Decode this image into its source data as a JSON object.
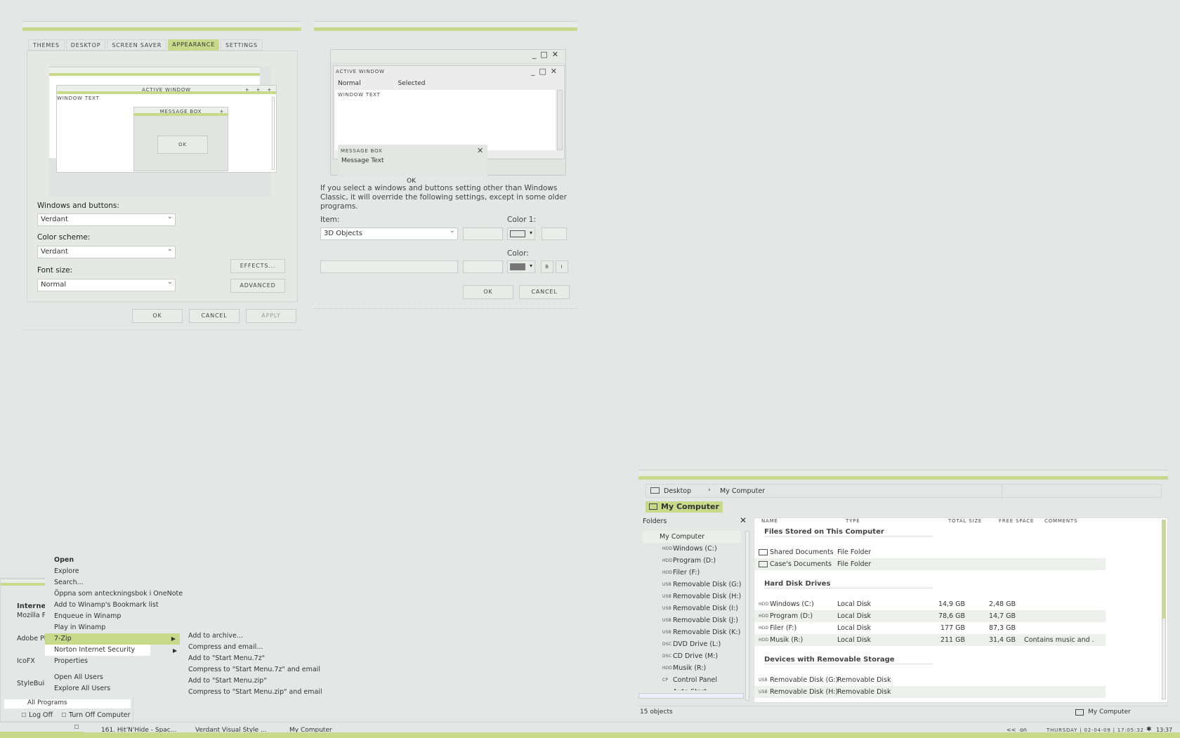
{
  "display_props": {
    "tabs": [
      {
        "label": "Themes"
      },
      {
        "label": "Desktop"
      },
      {
        "label": "Screen Saver"
      },
      {
        "label": "Appearance",
        "selected": true
      },
      {
        "label": "Settings"
      }
    ],
    "preview": {
      "active_window": "Active Window",
      "window_text": "Window Text",
      "message_box": "Message Box",
      "ok": "OK"
    },
    "windows_buttons_label": "Windows and buttons:",
    "windows_buttons_value": "Verdant",
    "color_scheme_label": "Color scheme:",
    "color_scheme_value": "Verdant",
    "font_size_label": "Font size:",
    "font_size_value": "Normal",
    "effects": "Effects...",
    "advanced": "Advanced",
    "ok": "OK",
    "cancel": "Cancel",
    "apply": "Apply"
  },
  "advanced_appearance": {
    "preview": {
      "active_window": "Active Window",
      "normal": "Normal",
      "selected": "Selected",
      "window_text": "Window Text",
      "message_box": "Message Box",
      "message_text": "Message Text",
      "ok": "OK"
    },
    "info": "If you select a windows and buttons setting other than Windows Classic, it will override the following settings, except in some older programs.",
    "item_label": "Item:",
    "item_value": "3D Objects",
    "color1_label": "Color 1:",
    "color_label": "Color:",
    "bold": "B",
    "italic": "I",
    "ok": "OK",
    "cancel": "Cancel"
  },
  "explorer": {
    "breadcrumb": [
      "Desktop",
      "My Computer"
    ],
    "title": "My Computer",
    "folders_label": "Folders",
    "tree": [
      {
        "tag": "",
        "label": "My Computer"
      },
      {
        "tag": "HDD",
        "label": "Windows (C:)"
      },
      {
        "tag": "HDD",
        "label": "Program (D:)"
      },
      {
        "tag": "HDD",
        "label": "Filer (F:)"
      },
      {
        "tag": "USB",
        "label": "Removable Disk (G:)"
      },
      {
        "tag": "USB",
        "label": "Removable Disk (H:)"
      },
      {
        "tag": "USB",
        "label": "Removable Disk (I:)"
      },
      {
        "tag": "USB",
        "label": "Removable Disk (J:)"
      },
      {
        "tag": "USB",
        "label": "Removable Disk (K:)"
      },
      {
        "tag": "DSC",
        "label": "DVD Drive (L:)"
      },
      {
        "tag": "DSC",
        "label": "CD Drive (M:)"
      },
      {
        "tag": "HDD",
        "label": "Musik (R:)"
      },
      {
        "tag": "CP",
        "label": "Control Panel"
      },
      {
        "tag": "",
        "label": "Auto Start"
      }
    ],
    "columns": [
      "Name",
      "Type",
      "Total Size",
      "Free Space",
      "Comments"
    ],
    "groups": [
      {
        "title": "Files Stored on This Computer",
        "rows": [
          {
            "tag": "",
            "name": "Shared Documents",
            "type": "File Folder",
            "total": "",
            "free": "",
            "comment": ""
          },
          {
            "tag": "",
            "name": "Case's Documents",
            "type": "File Folder",
            "total": "",
            "free": "",
            "comment": ""
          }
        ]
      },
      {
        "title": "Hard Disk Drives",
        "rows": [
          {
            "tag": "HDD",
            "name": "Windows (C:)",
            "type": "Local Disk",
            "total": "14,9 GB",
            "free": "2,48 GB",
            "comment": ""
          },
          {
            "tag": "HDD",
            "name": "Program (D:)",
            "type": "Local Disk",
            "total": "78,6 GB",
            "free": "14,7 GB",
            "comment": ""
          },
          {
            "tag": "HDD",
            "name": "Filer (F:)",
            "type": "Local Disk",
            "total": "177 GB",
            "free": "87,3 GB",
            "comment": ""
          },
          {
            "tag": "HDD",
            "name": "Musik (R:)",
            "type": "Local Disk",
            "total": "211 GB",
            "free": "31,4 GB",
            "comment": "Contains music and ..."
          }
        ]
      },
      {
        "title": "Devices with Removable Storage",
        "rows": [
          {
            "tag": "USB",
            "name": "Removable Disk (G:)",
            "type": "Removable Disk",
            "total": "",
            "free": "",
            "comment": ""
          },
          {
            "tag": "USB",
            "name": "Removable Disk (H:)",
            "type": "Removable Disk",
            "total": "",
            "free": "",
            "comment": ""
          }
        ]
      }
    ],
    "status_count": "15 objects",
    "status_location": "My Computer"
  },
  "start_menu": {
    "section": "Interne",
    "programs": [
      "Mozilla F",
      "Adobe Pl",
      "IcoFX",
      "StyleBuil"
    ],
    "all_programs": "All Programs",
    "log_off": "Log Off",
    "turn_off": "Turn Off Computer"
  },
  "context_menu": {
    "items": [
      "Open",
      "Explore",
      "Search...",
      "Öppna som anteckningsbok i OneNote",
      "Add to Winamp's Bookmark list",
      "Enqueue in Winamp",
      "Play in Winamp",
      "7-Zip",
      "Norton Internet Security",
      "Properties",
      "Open All Users",
      "Explore All Users"
    ],
    "submenu": [
      "Add to archive...",
      "Compress and email...",
      "Add to \"Start Menu.7z\"",
      "Compress to \"Start Menu.7z\" and email",
      "Add to \"Start Menu.zip\"",
      "Compress to \"Start Menu.zip\" and email"
    ]
  },
  "taskbar": {
    "tasks": [
      "161. Hit'N'Hide - Spac...",
      "Verdant Visual Style ...",
      "My Computer"
    ],
    "tray": [
      "<<",
      "on"
    ],
    "clock": "Thursday | 02-04-09 | 17:05:32",
    "time": "13:37"
  }
}
